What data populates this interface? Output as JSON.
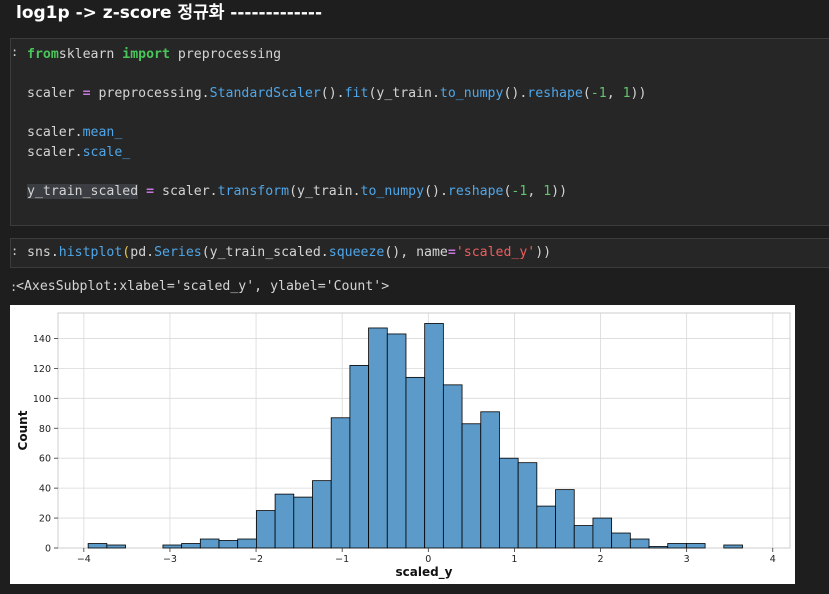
{
  "heading": "log1p -> z-score 정규화 -------------",
  "cell1": {
    "prompt": ":",
    "lines": [
      [
        [
          "kw",
          "from"
        ],
        [
          "",
          "sklearn "
        ],
        [
          "kw",
          "import"
        ],
        [
          "",
          " preprocessing"
        ]
      ],
      [],
      [
        [
          "",
          "scaler "
        ],
        [
          "op",
          "="
        ],
        [
          "",
          " preprocessing."
        ],
        [
          "fn",
          "StandardScaler"
        ],
        [
          "",
          "()."
        ],
        [
          "fn",
          "fit"
        ],
        [
          "",
          "(y_train."
        ],
        [
          "fn",
          "to_numpy"
        ],
        [
          "",
          "()."
        ],
        [
          "fn",
          "reshape"
        ],
        [
          "",
          "("
        ],
        [
          "num",
          "-1"
        ],
        [
          "",
          ", "
        ],
        [
          "num",
          "1"
        ],
        [
          "",
          "))"
        ]
      ],
      [],
      [
        [
          "",
          "scaler."
        ],
        [
          "fn",
          "mean_"
        ]
      ],
      [
        [
          "",
          "scaler."
        ],
        [
          "fn",
          "scale_"
        ]
      ],
      [],
      [
        [
          "sel",
          "y_train_scaled"
        ],
        [
          "",
          " "
        ],
        [
          "op",
          "="
        ],
        [
          "",
          " scaler."
        ],
        [
          "fn",
          "transform"
        ],
        [
          "",
          "(y_train."
        ],
        [
          "fn",
          "to_numpy"
        ],
        [
          "",
          "()."
        ],
        [
          "fn",
          "reshape"
        ],
        [
          "",
          "("
        ],
        [
          "num",
          "-1"
        ],
        [
          "",
          ", "
        ],
        [
          "num",
          "1"
        ],
        [
          "",
          "))"
        ]
      ]
    ]
  },
  "cell2": {
    "prompt": ":",
    "lines": [
      [
        [
          "",
          "sns."
        ],
        [
          "fn",
          "histplot"
        ],
        [
          "paren-y",
          "("
        ],
        [
          "",
          "pd."
        ],
        [
          "fn",
          "Series"
        ],
        [
          "",
          "(y_train_scaled."
        ],
        [
          "fn",
          "squeeze"
        ],
        [
          "",
          "(), name"
        ],
        [
          "op",
          "="
        ],
        [
          "str",
          "'scaled_y'"
        ],
        [
          "",
          "))"
        ],
        [
          "paren-y",
          ""
        ]
      ]
    ]
  },
  "output": {
    "prompt": ":",
    "text": "<AxesSubplot:xlabel='scaled_y', ylabel='Count'>"
  },
  "colors": {
    "bar_fill": "#5b9ac9",
    "bar_edge": "#000000",
    "grid": "#d9d9d9"
  },
  "chart_data": {
    "type": "bar",
    "xlabel": "scaled_y",
    "ylabel": "Count",
    "xlim": [
      -4.3,
      4.2
    ],
    "ylim": [
      0,
      157
    ],
    "xticks": [
      -4,
      -3,
      -2,
      -1,
      0,
      1,
      2,
      3,
      4
    ],
    "xtick_labels": [
      "−4",
      "−3",
      "−2",
      "−1",
      "0",
      "1",
      "2",
      "3",
      "4"
    ],
    "yticks": [
      0,
      20,
      40,
      60,
      80,
      100,
      120,
      140
    ],
    "grid": true,
    "bin_start": -3.95,
    "bin_width": 0.2171,
    "values": [
      3,
      2,
      0,
      0,
      2,
      3,
      6,
      5,
      6,
      25,
      36,
      34,
      45,
      87,
      122,
      147,
      143,
      114,
      150,
      109,
      83,
      91,
      60,
      57,
      28,
      39,
      15,
      20,
      10,
      6,
      1,
      3,
      3,
      0,
      2
    ]
  }
}
